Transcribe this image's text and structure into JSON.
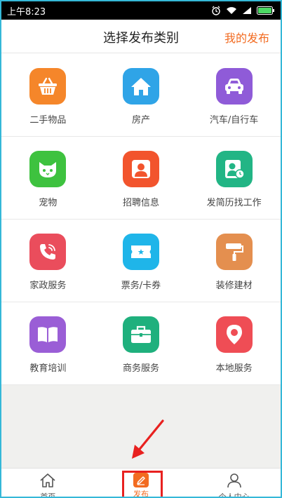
{
  "status_bar": {
    "time": "上午8:23"
  },
  "header": {
    "title": "选择发布类别",
    "right_link": "我的发布"
  },
  "categories": [
    {
      "label": "二手物品",
      "icon": "basket-icon",
      "color": "#f5862a"
    },
    {
      "label": "房产",
      "icon": "house-icon",
      "color": "#2fa4e7"
    },
    {
      "label": "汽车/自行车",
      "icon": "car-icon",
      "color": "#8f5bd8"
    },
    {
      "label": "宠物",
      "icon": "cat-icon",
      "color": "#3ec23f"
    },
    {
      "label": "招聘信息",
      "icon": "person-icon",
      "color": "#f2542d"
    },
    {
      "label": "发简历找工作",
      "icon": "resume-icon",
      "color": "#22b585"
    },
    {
      "label": "家政服务",
      "icon": "phone-icon",
      "color": "#ea4d5c"
    },
    {
      "label": "票务/卡券",
      "icon": "ticket-icon",
      "color": "#1fb5e9"
    },
    {
      "label": "装修建材",
      "icon": "paint-roller-icon",
      "color": "#e48f4f"
    },
    {
      "label": "教育培训",
      "icon": "book-icon",
      "color": "#9a5ed6"
    },
    {
      "label": "商务服务",
      "icon": "briefcase-icon",
      "color": "#1fb07d"
    },
    {
      "label": "本地服务",
      "icon": "location-pin-icon",
      "color": "#ef4d55"
    }
  ],
  "tabs": [
    {
      "label": "首页",
      "icon": "home-icon"
    },
    {
      "label": "发布",
      "icon": "publish-icon",
      "active": true
    },
    {
      "label": "个人中心",
      "icon": "user-icon"
    }
  ],
  "colors": {
    "accent": "#f26b21",
    "highlight": "#e8211f"
  }
}
